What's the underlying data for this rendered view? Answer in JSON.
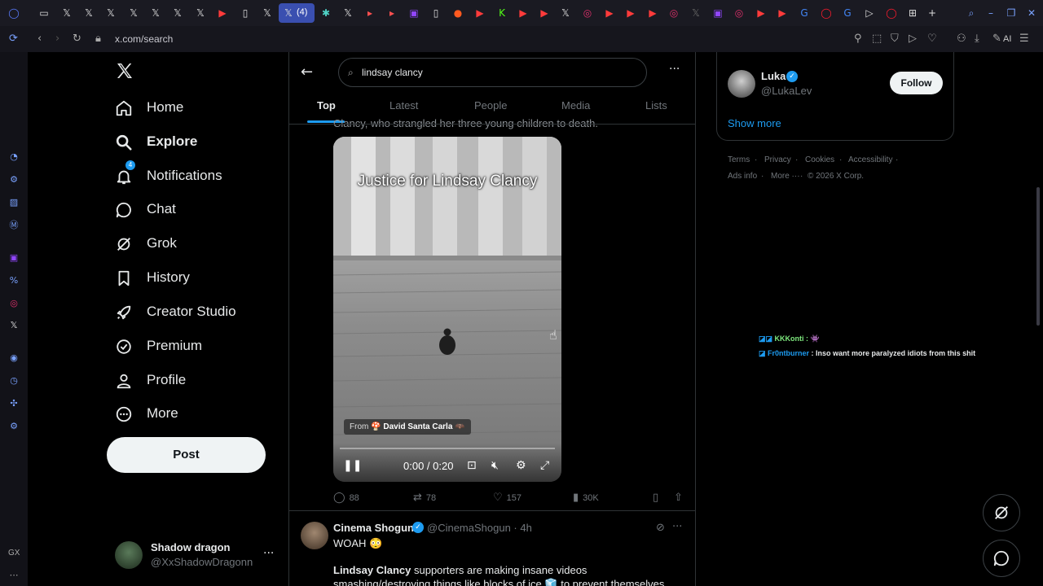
{
  "browser": {
    "url": "x.com/search",
    "tab_badge_count": "(4)",
    "ai_label": "AI",
    "sidebar_label": "GX",
    "tab_icons": [
      "opera-icon",
      "gamepad-icon",
      "x-icon",
      "x-icon",
      "x-icon",
      "x-icon",
      "x-icon",
      "x-icon",
      "x-icon",
      "youtube-icon",
      "doc-icon",
      "x-icon",
      "x-active-icon",
      "perplexity-icon",
      "x-icon",
      "shortcut-icon",
      "shortcut-icon",
      "twitch-icon",
      "doc-icon",
      "reddit-icon",
      "youtube-icon",
      "kick-icon",
      "youtube-icon",
      "youtube-icon",
      "x-icon",
      "instagram-icon",
      "youtube-icon",
      "youtube-icon",
      "youtube-icon",
      "instagram-icon",
      "x-icon",
      "twitch-icon",
      "instagram-icon",
      "youtube-icon",
      "youtube-icon",
      "google-icon",
      "opera-icon",
      "google-icon",
      "play-icon",
      "opera-icon",
      "grid-icon",
      "plus-icon"
    ]
  },
  "nav": {
    "home": "Home",
    "explore": "Explore",
    "notifications": "Notifications",
    "notifications_badge": "4",
    "chat": "Chat",
    "grok": "Grok",
    "history": "History",
    "creator_studio": "Creator Studio",
    "premium": "Premium",
    "profile": "Profile",
    "more": "More",
    "post": "Post"
  },
  "account": {
    "name": "Shadow dragon",
    "handle": "@XxShadowDragonn"
  },
  "search": {
    "query": "lindsay clancy"
  },
  "tabs": {
    "top": "Top",
    "latest": "Latest",
    "people": "People",
    "media": "Media",
    "lists": "Lists"
  },
  "tweet1": {
    "cut_text": "Clancy, who strangled her three young children to death.",
    "video_title": "Justice for Lindsay Clancy",
    "from_label": "From",
    "from_name": "David Santa Carla",
    "time": "0:00 / 0:20",
    "replies": "88",
    "reposts": "78",
    "likes": "157",
    "views": "30K"
  },
  "tweet2": {
    "name": "Cinema Shogun",
    "handle": "@CinemaShogun · 4h",
    "line1": "WOAH 😳",
    "body_bold": "Lindsay Clancy",
    "body_rest": " supporters are making insane videos smashing/destroying things like blocks of ice 🧊 to prevent themselves from bashing in their"
  },
  "right": {
    "suggest_name": "Luka",
    "suggest_handle": "@LukaLev",
    "follow": "Follow",
    "show_more": "Show more",
    "footer": {
      "terms": "Terms",
      "privacy": "Privacy",
      "cookies": "Cookies",
      "accessibility": "Accessibility",
      "ads_info": "Ads info",
      "more": "More ···",
      "copyright": "© 2026 X Corp."
    }
  },
  "chat_overlay": {
    "line1_user": "KKKonti :",
    "line2_user": "Fr0ntburner",
    "line2_text": " : Inso want more paralyzed idiots from this shit"
  },
  "colors": {
    "accent": "#1d9bf0",
    "background": "#000000",
    "text": "#e7e9ea",
    "muted": "#71767b",
    "border": "#2f3336"
  }
}
